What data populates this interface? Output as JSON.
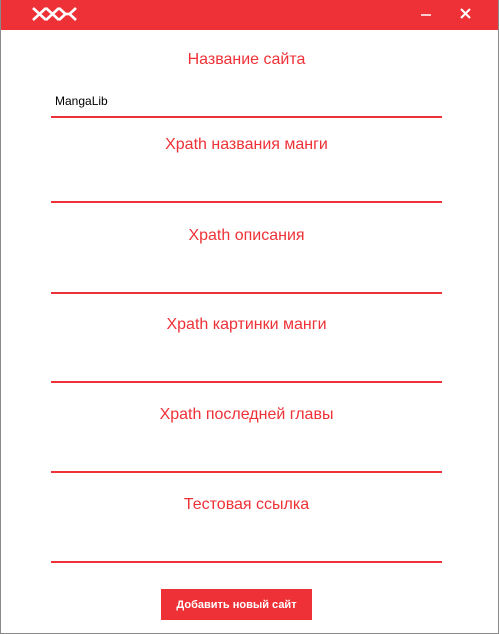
{
  "window": {
    "accent_color": "#ee3137",
    "logo_icon": "manga-logo-icon",
    "minimize_icon": "minimize-icon",
    "close_icon": "close-icon"
  },
  "form": {
    "fields": [
      {
        "label": "Название сайта",
        "value": "MangaLib"
      },
      {
        "label": "Xpath названия манги",
        "value": ""
      },
      {
        "label": "Xpath описания",
        "value": ""
      },
      {
        "label": "Xpath картинки манги",
        "value": ""
      },
      {
        "label": "Xpath последней главы",
        "value": ""
      },
      {
        "label": "Тестовая ссылка",
        "value": ""
      }
    ],
    "submit_label": "Добавить новый сайт"
  }
}
